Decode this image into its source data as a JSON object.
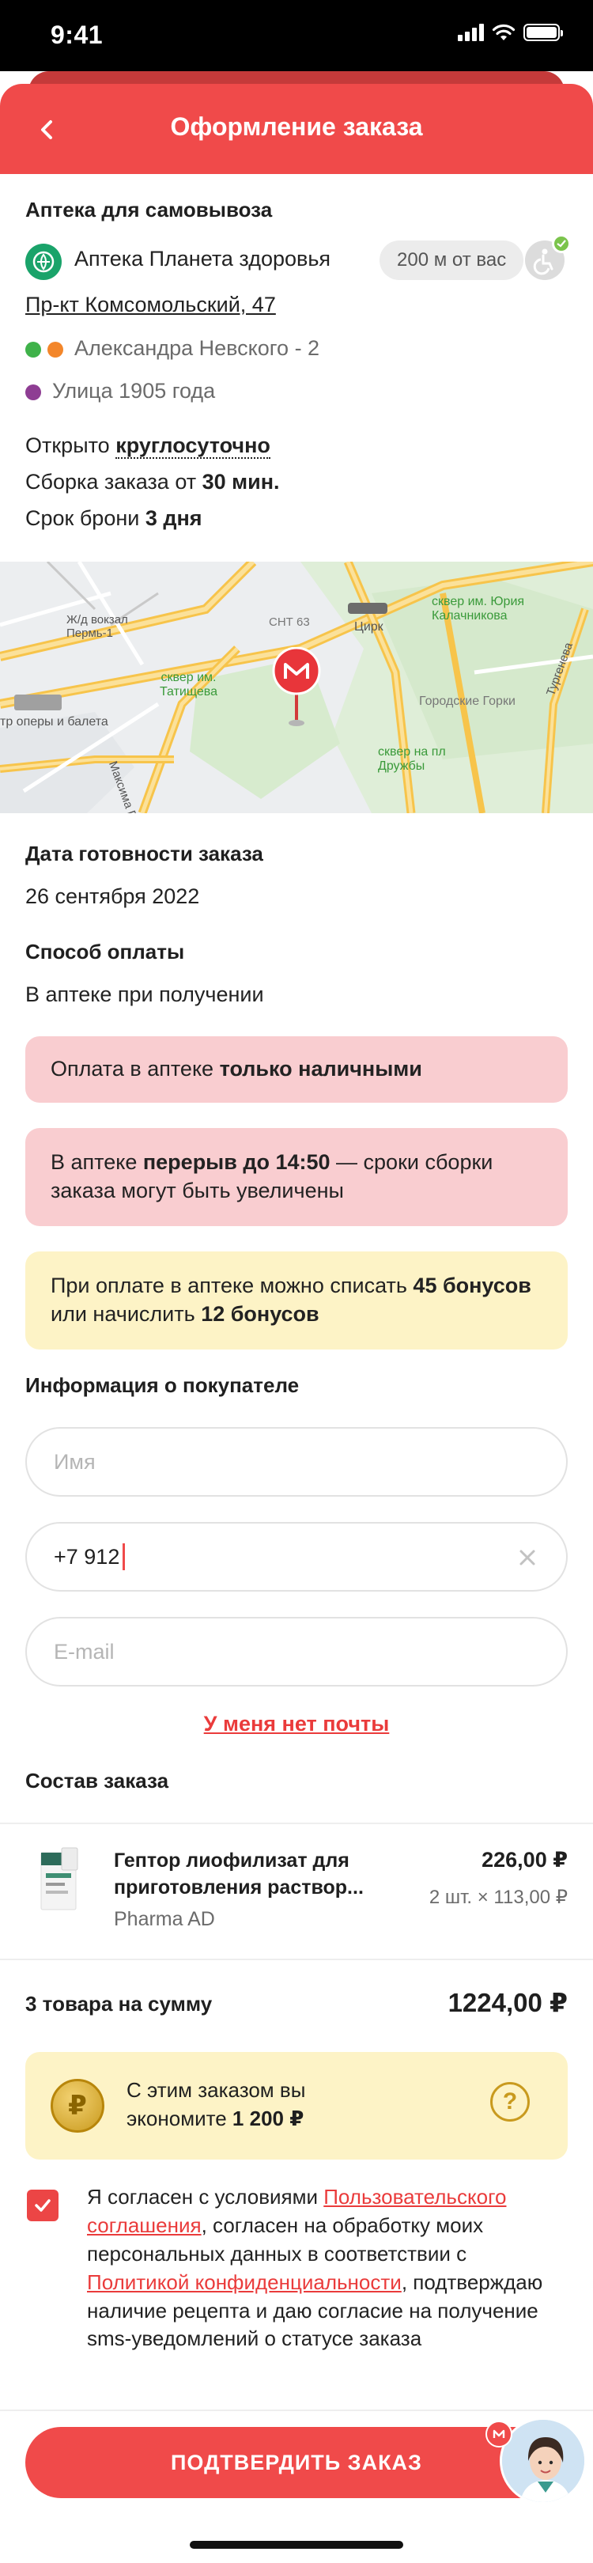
{
  "status_bar": {
    "time": "9:41"
  },
  "header": {
    "title": "Оформление заказа"
  },
  "pickup": {
    "section_title": "Аптека для самовывоза",
    "pharmacy_name": "Аптека Планета здоровья",
    "distance": "200 м от вас",
    "address": "Пр-кт Комсомольский, 47",
    "metro": [
      {
        "name": "Александра Невского - 2",
        "colors": [
          "#3fb24a",
          "#f3862a"
        ]
      },
      {
        "name": "Улица 1905 года",
        "colors": [
          "#8e3d93"
        ]
      }
    ],
    "open_prefix": "Открыто ",
    "open_value": "круглосуточно",
    "assembly_prefix": "Сборка заказа от ",
    "assembly_value": "30 мин.",
    "reserve_prefix": "Срок брони ",
    "reserve_value": "3 дня"
  },
  "map": {
    "labels": {
      "station": "Ж/д вокзал\nПермь-1",
      "sq_tatishcheva": "сквер им.\nТатищева",
      "circus": "Цирк",
      "snt": "СНТ 63",
      "sq_kalachnikova": "сквер им. Юрия\nКалачникова",
      "gorki": "Городские Горки",
      "turgeneva": "Тургенева",
      "sq_druzhby": "сквер на пл\nДружбы",
      "opera": "тр оперы и балета",
      "maxim_gorky": "Максима Горь"
    }
  },
  "ready": {
    "title": "Дата готовности заказа",
    "value": "26 сентября 2022"
  },
  "payment": {
    "title": "Способ оплаты",
    "value": "В аптеке при получении"
  },
  "alerts": {
    "cash_prefix": "Оплата в аптеке ",
    "cash_bold": "только наличными",
    "break_prefix": "В аптеке ",
    "break_bold": "перерыв до 14:50",
    "break_suffix": " — сроки сборки заказа могут быть увеличены",
    "bonus_prefix": "При оплате в аптеке можно списать ",
    "bonus_spend": "45 бонусов",
    "bonus_mid": " или начислить ",
    "bonus_earn": "12 бонусов"
  },
  "buyer": {
    "title": "Информация о покупателе",
    "name_placeholder": "Имя",
    "phone_value": "+7 912",
    "email_placeholder": "E-mail",
    "no_email_link": "У меня нет почты"
  },
  "order": {
    "title": "Состав заказа",
    "items": [
      {
        "name": "Гептор лиофилизат для приготовления раствор...",
        "maker": "Pharma AD",
        "price": "226,00 ₽",
        "qty": "2 шт. × 113,00 ₽"
      }
    ],
    "total_label": "3 товара на сумму",
    "total_value": "1224,00 ₽"
  },
  "savings": {
    "prefix": "С этим заказом вы экономите ",
    "amount": "1 200 ₽",
    "coin": "₽",
    "help": "?"
  },
  "consent": {
    "p1": "Я согласен с условиями ",
    "link1": "Пользовательского соглашения",
    "p2": ", согласен на обработку моих персональных данных в соответствии с ",
    "link2": "Политикой конфиденциальности",
    "p3": ", подтверждаю наличие рецепта и даю согласие на получение sms-уведомлений о статусе заказа"
  },
  "confirm": {
    "label": "ПОДТВЕРДИТЬ ЗАКАЗ"
  },
  "colors": {
    "accent": "#f04a4a",
    "alert_red": "#f9cdd0",
    "alert_yellow": "#fdf3c6",
    "pharmacy_green": "#1aa36a"
  }
}
